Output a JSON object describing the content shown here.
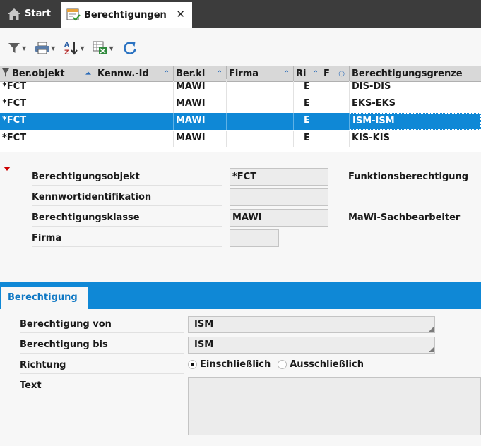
{
  "tabs": {
    "start_label": "Start",
    "active_label": "Berechtigungen",
    "close_glyph": "✕"
  },
  "toolbar": {
    "icons": [
      "filter-icon",
      "print-icon",
      "sort-az-icon",
      "excel-export-icon",
      "refresh-icon"
    ]
  },
  "grid": {
    "columns": [
      {
        "label": "Ber.objekt",
        "sort": "⌃"
      },
      {
        "label": "Kennw.-Id",
        "sort": "^"
      },
      {
        "label": "Ber.kl",
        "sort": "^"
      },
      {
        "label": "Firma",
        "sort": "^"
      },
      {
        "label": "Ri",
        "sort": "^"
      },
      {
        "label": "F",
        "sort": "○"
      },
      {
        "label": "Berechtigungsgrenze",
        "sort": ""
      }
    ],
    "rows": [
      {
        "objekt": "*FCT",
        "kennw": "",
        "berkl": "MAWI",
        "firma": "",
        "ri": "E",
        "f": "",
        "grenze": "DIS-DIS"
      },
      {
        "objekt": "*FCT",
        "kennw": "",
        "berkl": "MAWI",
        "firma": "",
        "ri": "E",
        "f": "",
        "grenze": "EKS-EKS"
      },
      {
        "objekt": "*FCT",
        "kennw": "",
        "berkl": "MAWI",
        "firma": "",
        "ri": "E",
        "f": "",
        "grenze": "ISM-ISM"
      },
      {
        "objekt": "*FCT",
        "kennw": "",
        "berkl": "MAWI",
        "firma": "",
        "ri": "E",
        "f": "",
        "grenze": "KIS-KIS"
      }
    ],
    "selected_row": 2
  },
  "detail": {
    "berechtigungsobjekt": {
      "label": "Berechtigungsobjekt",
      "value": "*FCT",
      "desc": "Funktionsberechtigung"
    },
    "kennwortidentifikation": {
      "label": "Kennwortidentifikation",
      "value": ""
    },
    "berechtigungsklasse": {
      "label": "Berechtigungsklasse",
      "value": "MAWI",
      "desc": "MaWi-Sachbearbeiter"
    },
    "firma": {
      "label": "Firma",
      "value": ""
    }
  },
  "berechtigung_tab": {
    "tab_label": "Berechtigung",
    "von": {
      "label": "Berechtigung von",
      "value": "ISM"
    },
    "bis": {
      "label": "Berechtigung bis",
      "value": "ISM"
    },
    "richtung": {
      "label": "Richtung",
      "option1": "Einschließlich",
      "option2": "Ausschließlich",
      "selected": "Einschließlich"
    },
    "text": {
      "label": "Text",
      "value": ""
    }
  },
  "colors": {
    "tabbar": "#3c3c3c",
    "selection": "#0f88d6",
    "accent_text": "#0f78c4",
    "collapse_marker": "#cc0000"
  }
}
